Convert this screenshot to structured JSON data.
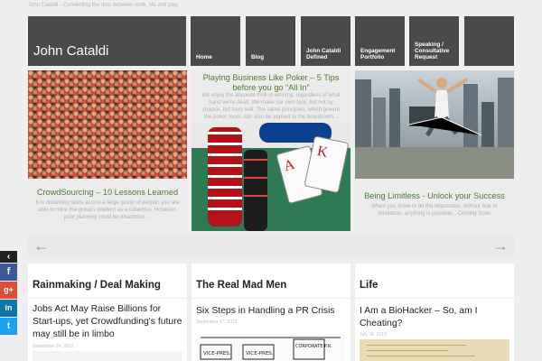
{
  "header": {
    "tagline": "John Cataldi - Connecting the dots between work, life and play",
    "site_title": "John Cataldi"
  },
  "nav": {
    "items": [
      {
        "label": "Home"
      },
      {
        "label": "Blog"
      },
      {
        "label": "John Cataldi Defined"
      },
      {
        "label": "Engagement Portfolio"
      },
      {
        "label": "Speaking / Consultative Request"
      },
      {
        "label": ""
      }
    ]
  },
  "featured": [
    {
      "title": "CrowdSourcing – 10 Lessons Learned",
      "excerpt": "It is disturbing tasks across a large group of people; you are able to mine the group's intellect as a collective. However, poor planning could be disastrous ..."
    },
    {
      "title": "Playing Business Like Poker – 5 Tips before you go “All In”",
      "excerpt": "We enjoy the absolute thrill of winning; regardless of what hand we're dealt. We make our own luck, but not by chance, but from skill. The same principles, which govern the poker room, can also be applied to the boardroom..."
    },
    {
      "title": "Being Limitless - Unlock your Success",
      "excerpt": "When you strive to do the impossible, without fear or hesitation, anything is possible... Coming Soon"
    }
  ],
  "slider": {
    "prev": "←",
    "next": "→"
  },
  "columns": [
    {
      "heading": "Rainmaking / Deal Making",
      "post_title": "Jobs Act May Raise Billions for Start-ups, yet Crowdfunding's future may still be in limbo",
      "post_date": "September 24, 2013"
    },
    {
      "heading": "The Real Mad Men",
      "post_title": "Six Steps in Handling a PR Crisis",
      "post_date": "September 17, 2013",
      "sketch": [
        "VICE-PRES.",
        "VICE-PRES.",
        "CORPORATE P.R."
      ]
    },
    {
      "heading": "Life",
      "post_title": "I Am a BioHacker – So, am I Cheating?",
      "post_date": "July 24, 2013"
    }
  ],
  "social": [
    {
      "label": "‹",
      "color": "#222222"
    },
    {
      "label": "f",
      "color": "#3b5998"
    },
    {
      "label": "g+",
      "color": "#dd4b39"
    },
    {
      "label": "in",
      "color": "#0e76a8"
    },
    {
      "label": "t",
      "color": "#1da1f2"
    }
  ],
  "colors": {
    "tile": "#4a4a4a",
    "title_link": "#4f7a33",
    "background": "#efefef"
  }
}
